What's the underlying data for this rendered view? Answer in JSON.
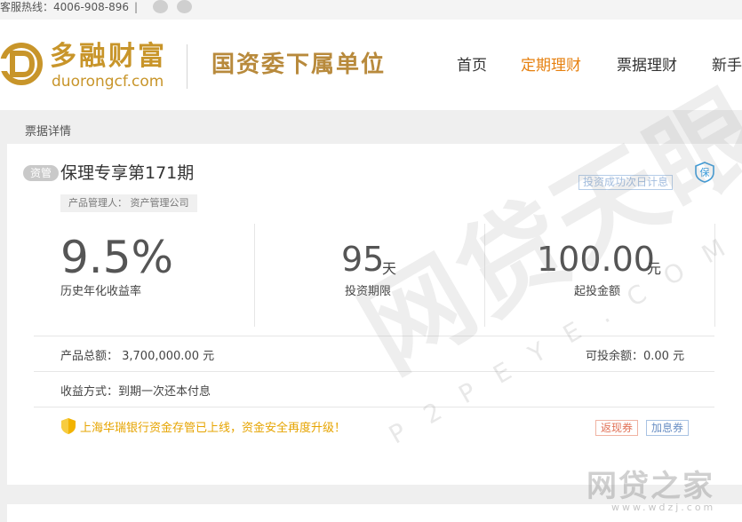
{
  "topbar": {
    "hotline": "客服热线：4006-908-896",
    "separator": "|"
  },
  "header": {
    "brand_cn": "多融财富",
    "brand_url": "duorongcf.com",
    "slogan": "国资委下属单位",
    "nav": [
      {
        "label": "首页",
        "active": false
      },
      {
        "label": "定期理财",
        "active": true
      },
      {
        "label": "票据理财",
        "active": false
      },
      {
        "label": "新手",
        "active": false
      }
    ]
  },
  "breadcrumb": "票据详情",
  "product": {
    "badge": "资管",
    "title": "保理专享第171期",
    "manager": "产品管理人： 资产管理公司",
    "count_tag": "投资成功次日计息",
    "rate_value": "9.5%",
    "rate_label": "历史年化收益率",
    "term_value": "95",
    "term_unit": "天",
    "term_label": "投资期限",
    "min_value": "100.00",
    "min_unit": "元",
    "min_label": "起投金额",
    "total": "产品总额： 3,700,000.00 元",
    "remaining": "可投余额：0.00 元",
    "method": "收益方式：到期一次还本付息",
    "bank_notice": "上海华瑞银行资金存管已上线，资金安全再度升级！",
    "coupon_cash": "返现券",
    "coupon_rate": "加息券"
  },
  "watermarks": {
    "big": "网贷天眼",
    "letters": "P2PEYE.COM",
    "corner": "网贷之家",
    "corner_url": "www.wdzj.com"
  },
  "colors": {
    "brand_gold": "#c8952a",
    "nav_active": "#e6800f",
    "notice_yellow": "#e6a400"
  }
}
